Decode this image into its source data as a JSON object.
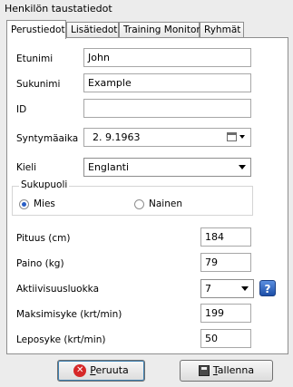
{
  "window": {
    "group_title": "Henkilön taustatiedot"
  },
  "tabs": [
    {
      "label": "Perustiedot"
    },
    {
      "label": "Lisätiedot"
    },
    {
      "label": "Training Monitor"
    },
    {
      "label": "Ryhmät"
    }
  ],
  "form": {
    "first_name": {
      "label": "Etunimi",
      "value": "John"
    },
    "last_name": {
      "label": "Sukunimi",
      "value": "Example"
    },
    "id": {
      "label": "ID",
      "value": ""
    },
    "birth_date": {
      "label": "Syntymäaika",
      "value": "2.  9.1963"
    },
    "language": {
      "label": "Kieli",
      "value": "Englanti"
    },
    "gender": {
      "legend": "Sukupuoli",
      "male": "Mies",
      "female": "Nainen",
      "selected": "Mies"
    },
    "height": {
      "label": "Pituus (cm)",
      "value": "184"
    },
    "weight": {
      "label": "Paino (kg)",
      "value": "79"
    },
    "activity": {
      "label": "Aktiivisuusluokka",
      "value": "7"
    },
    "max_hr": {
      "label": "Maksimisyke (krt/min)",
      "value": "199"
    },
    "rest_hr": {
      "label": "Leposyke (krt/min)",
      "value": "50"
    }
  },
  "buttons": {
    "cancel_first": "P",
    "cancel_rest": "eruuta",
    "save_first": "T",
    "save_rest": "allenna",
    "help": "?"
  }
}
